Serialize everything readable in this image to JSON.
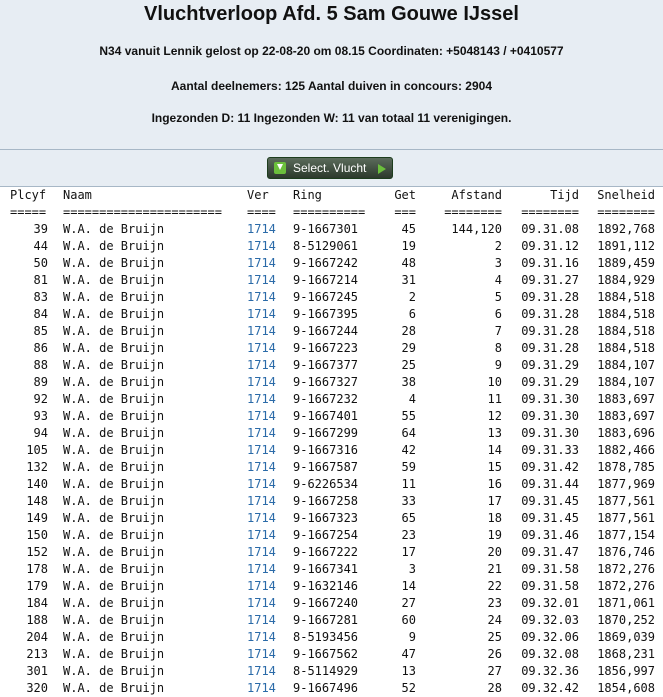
{
  "header": {
    "title": "Vluchtverloop Afd. 5 Sam Gouwe IJssel",
    "line1": "N34 vanuit Lennik gelost op 22-08-20 om 08.15 Coordinaten: +5048143 / +0410577",
    "line2": "Aantal deelnemers: 125 Aantal duiven in concours: 2904",
    "line3": "Ingezonden D: 11 Ingezonden W: 11 van totaal 11 verenigingen."
  },
  "toolbar": {
    "select_label": "Select. Vlucht"
  },
  "table": {
    "headers": {
      "plcyf": "Plcyf",
      "naam": "Naam",
      "ver": "Ver",
      "ring": "Ring",
      "get": "Get",
      "afstand": "Afstand",
      "tijd": "Tijd",
      "snelheid": "Snelheid"
    },
    "separators": {
      "plcyf": "=====",
      "naam": "======================",
      "ver": "====",
      "ring": "==========",
      "get": "===",
      "afstand": "========",
      "tijd": "========",
      "snelheid": "========"
    },
    "rows": [
      {
        "plcyf": "39",
        "naam": "W.A. de Bruijn",
        "ver": "1714",
        "ring": "9-1667301",
        "get": "45",
        "afstand": "144,120",
        "tijd": "09.31.08",
        "snelheid": "1892,768"
      },
      {
        "plcyf": "44",
        "naam": "W.A. de Bruijn",
        "ver": "1714",
        "ring": "8-5129061",
        "get": "19",
        "afstand": "2",
        "tijd": "09.31.12",
        "snelheid": "1891,112"
      },
      {
        "plcyf": "50",
        "naam": "W.A. de Bruijn",
        "ver": "1714",
        "ring": "9-1667242",
        "get": "48",
        "afstand": "3",
        "tijd": "09.31.16",
        "snelheid": "1889,459"
      },
      {
        "plcyf": "81",
        "naam": "W.A. de Bruijn",
        "ver": "1714",
        "ring": "9-1667214",
        "get": "31",
        "afstand": "4",
        "tijd": "09.31.27",
        "snelheid": "1884,929"
      },
      {
        "plcyf": "83",
        "naam": "W.A. de Bruijn",
        "ver": "1714",
        "ring": "9-1667245",
        "get": "2",
        "afstand": "5",
        "tijd": "09.31.28",
        "snelheid": "1884,518"
      },
      {
        "plcyf": "84",
        "naam": "W.A. de Bruijn",
        "ver": "1714",
        "ring": "9-1667395",
        "get": "6",
        "afstand": "6",
        "tijd": "09.31.28",
        "snelheid": "1884,518"
      },
      {
        "plcyf": "85",
        "naam": "W.A. de Bruijn",
        "ver": "1714",
        "ring": "9-1667244",
        "get": "28",
        "afstand": "7",
        "tijd": "09.31.28",
        "snelheid": "1884,518"
      },
      {
        "plcyf": "86",
        "naam": "W.A. de Bruijn",
        "ver": "1714",
        "ring": "9-1667223",
        "get": "29",
        "afstand": "8",
        "tijd": "09.31.28",
        "snelheid": "1884,518"
      },
      {
        "plcyf": "88",
        "naam": "W.A. de Bruijn",
        "ver": "1714",
        "ring": "9-1667377",
        "get": "25",
        "afstand": "9",
        "tijd": "09.31.29",
        "snelheid": "1884,107"
      },
      {
        "plcyf": "89",
        "naam": "W.A. de Bruijn",
        "ver": "1714",
        "ring": "9-1667327",
        "get": "38",
        "afstand": "10",
        "tijd": "09.31.29",
        "snelheid": "1884,107"
      },
      {
        "plcyf": "92",
        "naam": "W.A. de Bruijn",
        "ver": "1714",
        "ring": "9-1667232",
        "get": "4",
        "afstand": "11",
        "tijd": "09.31.30",
        "snelheid": "1883,697"
      },
      {
        "plcyf": "93",
        "naam": "W.A. de Bruijn",
        "ver": "1714",
        "ring": "9-1667401",
        "get": "55",
        "afstand": "12",
        "tijd": "09.31.30",
        "snelheid": "1883,697"
      },
      {
        "plcyf": "94",
        "naam": "W.A. de Bruijn",
        "ver": "1714",
        "ring": "9-1667299",
        "get": "64",
        "afstand": "13",
        "tijd": "09.31.30",
        "snelheid": "1883,696"
      },
      {
        "plcyf": "105",
        "naam": "W.A. de Bruijn",
        "ver": "1714",
        "ring": "9-1667316",
        "get": "42",
        "afstand": "14",
        "tijd": "09.31.33",
        "snelheid": "1882,466"
      },
      {
        "plcyf": "132",
        "naam": "W.A. de Bruijn",
        "ver": "1714",
        "ring": "9-1667587",
        "get": "59",
        "afstand": "15",
        "tijd": "09.31.42",
        "snelheid": "1878,785"
      },
      {
        "plcyf": "140",
        "naam": "W.A. de Bruijn",
        "ver": "1714",
        "ring": "9-6226534",
        "get": "11",
        "afstand": "16",
        "tijd": "09.31.44",
        "snelheid": "1877,969"
      },
      {
        "plcyf": "148",
        "naam": "W.A. de Bruijn",
        "ver": "1714",
        "ring": "9-1667258",
        "get": "33",
        "afstand": "17",
        "tijd": "09.31.45",
        "snelheid": "1877,561"
      },
      {
        "plcyf": "149",
        "naam": "W.A. de Bruijn",
        "ver": "1714",
        "ring": "9-1667323",
        "get": "65",
        "afstand": "18",
        "tijd": "09.31.45",
        "snelheid": "1877,561"
      },
      {
        "plcyf": "150",
        "naam": "W.A. de Bruijn",
        "ver": "1714",
        "ring": "9-1667254",
        "get": "23",
        "afstand": "19",
        "tijd": "09.31.46",
        "snelheid": "1877,154"
      },
      {
        "plcyf": "152",
        "naam": "W.A. de Bruijn",
        "ver": "1714",
        "ring": "9-1667222",
        "get": "17",
        "afstand": "20",
        "tijd": "09.31.47",
        "snelheid": "1876,746"
      },
      {
        "plcyf": "178",
        "naam": "W.A. de Bruijn",
        "ver": "1714",
        "ring": "9-1667341",
        "get": "3",
        "afstand": "21",
        "tijd": "09.31.58",
        "snelheid": "1872,276"
      },
      {
        "plcyf": "179",
        "naam": "W.A. de Bruijn",
        "ver": "1714",
        "ring": "9-1632146",
        "get": "14",
        "afstand": "22",
        "tijd": "09.31.58",
        "snelheid": "1872,276"
      },
      {
        "plcyf": "184",
        "naam": "W.A. de Bruijn",
        "ver": "1714",
        "ring": "9-1667240",
        "get": "27",
        "afstand": "23",
        "tijd": "09.32.01",
        "snelheid": "1871,061"
      },
      {
        "plcyf": "188",
        "naam": "W.A. de Bruijn",
        "ver": "1714",
        "ring": "9-1667281",
        "get": "60",
        "afstand": "24",
        "tijd": "09.32.03",
        "snelheid": "1870,252"
      },
      {
        "plcyf": "204",
        "naam": "W.A. de Bruijn",
        "ver": "1714",
        "ring": "8-5193456",
        "get": "9",
        "afstand": "25",
        "tijd": "09.32.06",
        "snelheid": "1869,039"
      },
      {
        "plcyf": "213",
        "naam": "W.A. de Bruijn",
        "ver": "1714",
        "ring": "9-1667562",
        "get": "47",
        "afstand": "26",
        "tijd": "09.32.08",
        "snelheid": "1868,231"
      },
      {
        "plcyf": "301",
        "naam": "W.A. de Bruijn",
        "ver": "1714",
        "ring": "8-5114929",
        "get": "13",
        "afstand": "27",
        "tijd": "09.32.36",
        "snelheid": "1856,997"
      },
      {
        "plcyf": "320",
        "naam": "W.A. de Bruijn",
        "ver": "1714",
        "ring": "9-1667496",
        "get": "52",
        "afstand": "28",
        "tijd": "09.32.42",
        "snelheid": "1854,608"
      }
    ]
  },
  "colors": {
    "header_bg": "#e7edf3",
    "link": "#2a6aa8",
    "button_bg": "#3a4a3a",
    "button_icon": "#6bbf3c"
  }
}
